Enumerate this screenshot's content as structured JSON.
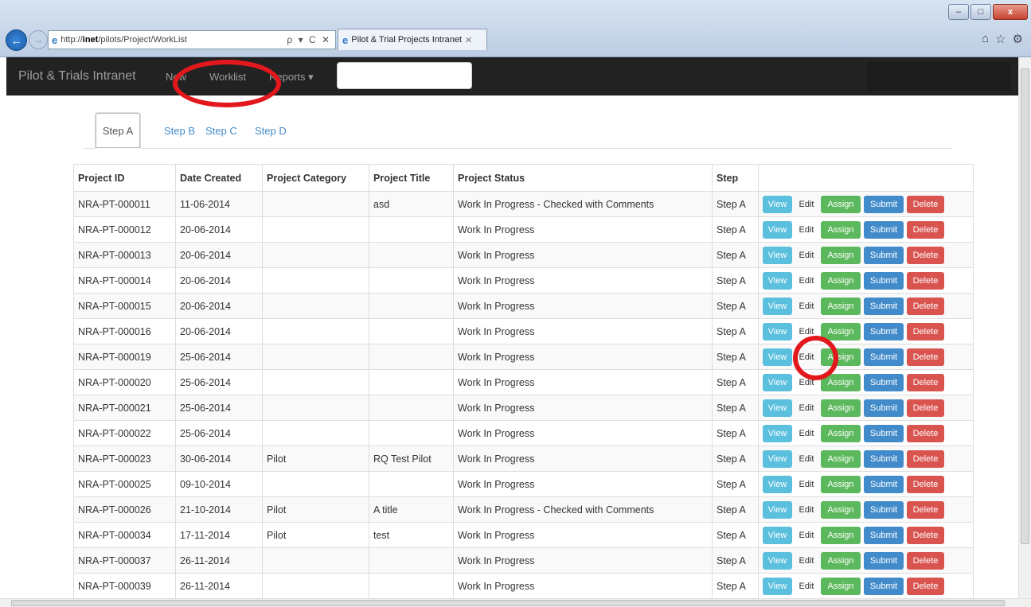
{
  "browser": {
    "url_prefix": "http://",
    "url_host": "inet",
    "url_path": "/pilots/Project/WorkList",
    "tab_title": "Pilot & Trial Projects Intranet",
    "addr_controls": "ρ ▾ C ✕",
    "tab_close": "✕",
    "win_min": "–",
    "win_max": "□",
    "win_close": "x"
  },
  "navbar": {
    "brand": "Pilot & Trials Intranet",
    "new": "New",
    "worklist": "Worklist",
    "reports": "Reports ▾"
  },
  "steps": [
    "Step A",
    "Step B",
    "Step C",
    "Step D"
  ],
  "table": {
    "headers": [
      "Project ID",
      "Date Created",
      "Project Category",
      "Project Title",
      "Project Status",
      "Step"
    ],
    "actions": {
      "view": "View",
      "edit": "Edit",
      "assign": "Assign",
      "submit": "Submit",
      "delete": "Delete"
    },
    "rows": [
      [
        "NRA-PT-000011",
        "11-06-2014",
        "",
        "asd",
        "Work In Progress - Checked with Comments",
        "Step A"
      ],
      [
        "NRA-PT-000012",
        "20-06-2014",
        "",
        "",
        "Work In Progress",
        "Step A"
      ],
      [
        "NRA-PT-000013",
        "20-06-2014",
        "",
        "",
        "Work In Progress",
        "Step A"
      ],
      [
        "NRA-PT-000014",
        "20-06-2014",
        "",
        "",
        "Work In Progress",
        "Step A"
      ],
      [
        "NRA-PT-000015",
        "20-06-2014",
        "",
        "",
        "Work In Progress",
        "Step A"
      ],
      [
        "NRA-PT-000016",
        "20-06-2014",
        "",
        "",
        "Work In Progress",
        "Step A"
      ],
      [
        "NRA-PT-000019",
        "25-06-2014",
        "",
        "",
        "Work In Progress",
        "Step A"
      ],
      [
        "NRA-PT-000020",
        "25-06-2014",
        "",
        "",
        "Work In Progress",
        "Step A"
      ],
      [
        "NRA-PT-000021",
        "25-06-2014",
        "",
        "",
        "Work In Progress",
        "Step A"
      ],
      [
        "NRA-PT-000022",
        "25-06-2014",
        "",
        "",
        "Work In Progress",
        "Step A"
      ],
      [
        "NRA-PT-000023",
        "30-06-2014",
        "Pilot",
        "RQ Test Pilot",
        "Work In Progress",
        "Step A"
      ],
      [
        "NRA-PT-000025",
        "09-10-2014",
        "",
        "",
        "Work In Progress",
        "Step A"
      ],
      [
        "NRA-PT-000026",
        "21-10-2014",
        "Pilot",
        "A title",
        "Work In Progress - Checked with Comments",
        "Step A"
      ],
      [
        "NRA-PT-000034",
        "17-11-2014",
        "Pilot",
        "test",
        "Work In Progress",
        "Step A"
      ],
      [
        "NRA-PT-000037",
        "26-11-2014",
        "",
        "",
        "Work In Progress",
        "Step A"
      ],
      [
        "NRA-PT-000039",
        "26-11-2014",
        "",
        "",
        "Work In Progress",
        "Step A"
      ]
    ]
  },
  "colors": {
    "view": "#5bc0de",
    "assign": "#5cb85c",
    "submit": "#428bca",
    "delete": "#d9534f",
    "highlight": "#e2181d"
  }
}
